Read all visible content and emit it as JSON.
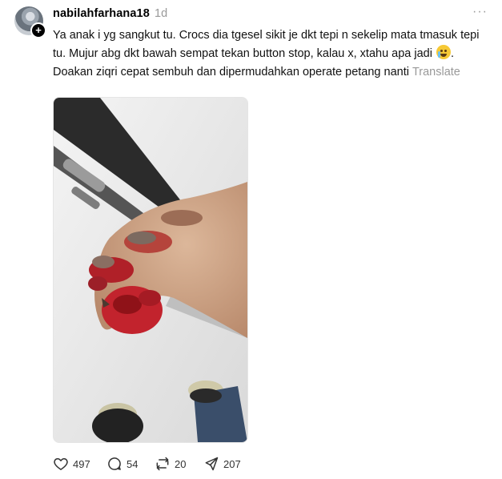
{
  "post": {
    "username": "nabilahfarhana18",
    "time": "1d",
    "more": "···",
    "text_part1": "Ya anak i yg sangkut tu. Crocs dia tgesel sikit je dkt tepi n sekelip mata tmasuk tepi tu. Mujur abg dkt bawah sempat tekan button stop, kalau x, xtahu apa jadi ",
    "text_part2": ". Doakan ziqri cepat sembuh dan dipermudahkan operate petang nanti",
    "translate": "Translate",
    "emoji_icon": "crying-face-emoji"
  },
  "actions": {
    "likes": "497",
    "comments": "54",
    "reposts": "20",
    "shares": "207"
  },
  "colors": {
    "muted": "#999999",
    "text": "#111111"
  }
}
